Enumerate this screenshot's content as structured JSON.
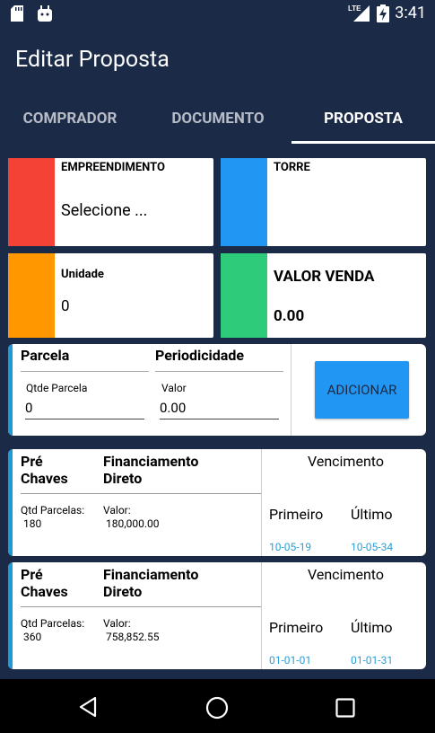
{
  "statusbar": {
    "time": "3:41",
    "network": "LTE"
  },
  "appbar": {
    "title": "Editar Proposta"
  },
  "tabs": [
    {
      "label": "COMPRADOR"
    },
    {
      "label": "DOCUMENTO"
    },
    {
      "label": "PROPOSTA"
    }
  ],
  "cards": {
    "empreendimento": {
      "label": "EMPREENDIMENTO",
      "value": "Selecione ...",
      "color": "#f44336"
    },
    "torre": {
      "label": "TORRE",
      "value": "",
      "color": "#2196f3"
    },
    "unidade": {
      "label": "Unidade",
      "value": "0",
      "color": "#ff9800"
    },
    "valor_venda": {
      "label": "VALOR VENDA",
      "value": "0.00",
      "color": "#2ecc7a"
    }
  },
  "parcela_form": {
    "parcela_title": "Parcela",
    "periodicidade_title": "Periodicidade",
    "qtde_label": "Qtde Parcela",
    "qtde_value": "0",
    "valor_label": "Valor",
    "valor_value": "0.00",
    "add_button": "ADICIONAR"
  },
  "parcelas": [
    {
      "type_l1": "Pré",
      "type_l2": "Chaves",
      "periodicity_l1": "Financiamento",
      "periodicity_l2": "Direto",
      "qtd_label": "Qtd Parcelas:",
      "qtd_value": "180",
      "valor_label": "Valor:",
      "valor_value": "180,000.00",
      "vencimento": "Vencimento",
      "primeiro_label": "Primeiro",
      "ultimo_label": "Último",
      "primeiro_date": "10-05-19",
      "ultimo_date": "10-05-34"
    },
    {
      "type_l1": "Pré",
      "type_l2": "Chaves",
      "periodicity_l1": "Financiamento",
      "periodicity_l2": "Direto",
      "qtd_label": "Qtd Parcelas:",
      "qtd_value": "360",
      "valor_label": "Valor:",
      "valor_value": "758,852.55",
      "vencimento": "Vencimento",
      "primeiro_label": "Primeiro",
      "ultimo_label": "Último",
      "primeiro_date": "01-01-01",
      "ultimo_date": "01-01-31"
    }
  ],
  "navbar": {
    "back": "back-icon",
    "home": "home-icon",
    "recents": "recents-icon"
  }
}
